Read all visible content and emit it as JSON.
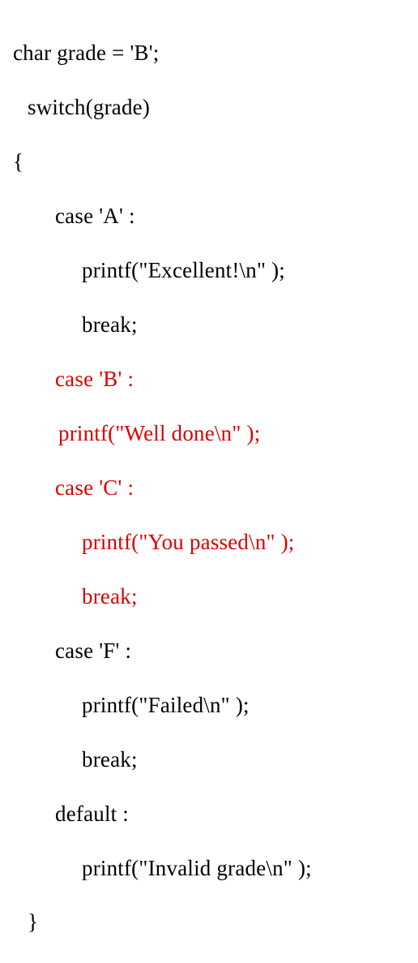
{
  "code": {
    "l1": "char grade = 'B';",
    "l2": "switch(grade)",
    "l3": "{",
    "l4": "case 'A' :",
    "l5": "printf(\"Excellent!\\n\" );",
    "l6": "break;",
    "l7": "case 'B' :",
    "l8": "printf(\"Well done\\n\" );",
    "l9": "case 'C' :",
    "l10": "printf(\"You passed\\n\" );",
    "l11": "break;",
    "l12": "case 'F' :",
    "l13": "printf(\"Failed\\n\" );",
    "l14": "break;",
    "l15": "default :",
    "l16": "printf(\"Invalid grade\\n\" );",
    "l17": "}"
  }
}
